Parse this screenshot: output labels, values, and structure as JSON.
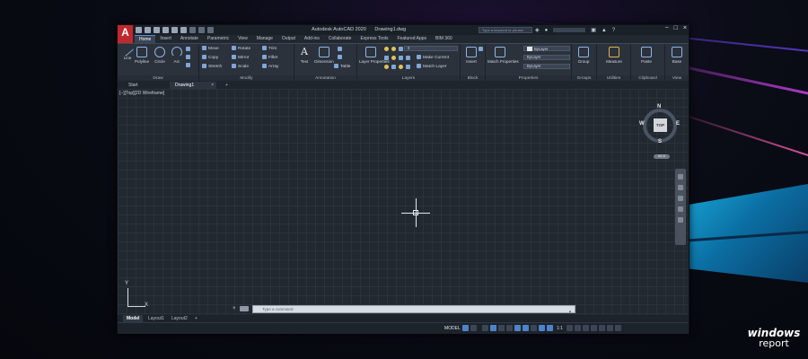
{
  "window": {
    "app_title": "Autodesk AutoCAD 2020",
    "file_title": "Drawing1.dwg",
    "app_logo": "A",
    "search_placeholder": "Type a keyword or phrase",
    "controls": [
      "−",
      "□",
      "×"
    ]
  },
  "ribbon": {
    "tabs": [
      "Home",
      "Insert",
      "Annotate",
      "Parametric",
      "View",
      "Manage",
      "Output",
      "Add-ins",
      "Collaborate",
      "Express Tools",
      "Featured Apps",
      "BIM 360"
    ],
    "active_tab": "Home",
    "draw": {
      "title": "Draw",
      "tools": [
        "Line",
        "Polyline",
        "Circle",
        "Arc"
      ]
    },
    "modify": {
      "title": "Modify",
      "tools": [
        "Move",
        "Rotate",
        "Trim",
        "Copy",
        "Mirror",
        "Fillet",
        "Stretch",
        "Scale",
        "Array"
      ]
    },
    "annotation": {
      "title": "Annotation",
      "tools": [
        "Text",
        "Dimension",
        "Table"
      ]
    },
    "layers": {
      "title": "Layers",
      "tools": [
        "Layer Properties",
        "Make Current",
        "Match Layer"
      ],
      "current_layer": "0"
    },
    "block": {
      "title": "Block",
      "tools": [
        "Insert"
      ]
    },
    "properties": {
      "title": "Properties",
      "tools": [
        "Match Properties"
      ],
      "color": "ByLayer",
      "linetype": "ByLayer",
      "lineweight": "ByLayer"
    },
    "groups": {
      "title": "Groups",
      "tools": [
        "Group"
      ]
    },
    "utilities": {
      "title": "Utilities",
      "tools": [
        "Measure"
      ]
    },
    "clipboard": {
      "title": "Clipboard",
      "tools": [
        "Paste"
      ]
    },
    "view": {
      "title": "View",
      "tools": [
        "Base"
      ]
    }
  },
  "file_tabs": {
    "start": "Start",
    "drawing": "Drawing1",
    "close": "×",
    "add": "+"
  },
  "canvas": {
    "viewport_label": "[−][Top][2D Wireframe]",
    "viewcube": {
      "top": "TOP",
      "north": "N",
      "south": "S",
      "east": "E",
      "west": "W"
    },
    "wcs": "WCS",
    "ucs_x": "X",
    "ucs_y": "Y"
  },
  "command_line": {
    "close": "×",
    "placeholder": "Type a command"
  },
  "layout_tabs": [
    "Model",
    "Layout1",
    "Layout2",
    "+"
  ],
  "status_bar": {
    "mode": "MODEL",
    "scale": "1:1"
  },
  "watermark": {
    "line1": "windows",
    "line2": "report"
  },
  "colors": {
    "logo_red": "#c0282d",
    "accent_blue": "#4b84c9",
    "canvas_bg": "#212830"
  }
}
